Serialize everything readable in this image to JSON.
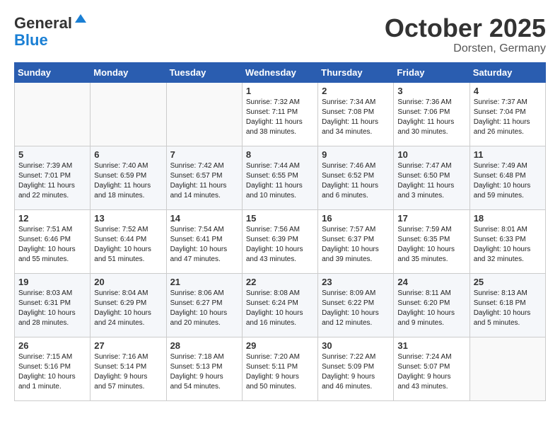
{
  "header": {
    "logo_line1": "General",
    "logo_line2": "Blue",
    "month": "October 2025",
    "location": "Dorsten, Germany"
  },
  "days_of_week": [
    "Sunday",
    "Monday",
    "Tuesday",
    "Wednesday",
    "Thursday",
    "Friday",
    "Saturday"
  ],
  "weeks": [
    [
      {
        "num": "",
        "info": ""
      },
      {
        "num": "",
        "info": ""
      },
      {
        "num": "",
        "info": ""
      },
      {
        "num": "1",
        "info": "Sunrise: 7:32 AM\nSunset: 7:11 PM\nDaylight: 11 hours\nand 38 minutes."
      },
      {
        "num": "2",
        "info": "Sunrise: 7:34 AM\nSunset: 7:08 PM\nDaylight: 11 hours\nand 34 minutes."
      },
      {
        "num": "3",
        "info": "Sunrise: 7:36 AM\nSunset: 7:06 PM\nDaylight: 11 hours\nand 30 minutes."
      },
      {
        "num": "4",
        "info": "Sunrise: 7:37 AM\nSunset: 7:04 PM\nDaylight: 11 hours\nand 26 minutes."
      }
    ],
    [
      {
        "num": "5",
        "info": "Sunrise: 7:39 AM\nSunset: 7:01 PM\nDaylight: 11 hours\nand 22 minutes."
      },
      {
        "num": "6",
        "info": "Sunrise: 7:40 AM\nSunset: 6:59 PM\nDaylight: 11 hours\nand 18 minutes."
      },
      {
        "num": "7",
        "info": "Sunrise: 7:42 AM\nSunset: 6:57 PM\nDaylight: 11 hours\nand 14 minutes."
      },
      {
        "num": "8",
        "info": "Sunrise: 7:44 AM\nSunset: 6:55 PM\nDaylight: 11 hours\nand 10 minutes."
      },
      {
        "num": "9",
        "info": "Sunrise: 7:46 AM\nSunset: 6:52 PM\nDaylight: 11 hours\nand 6 minutes."
      },
      {
        "num": "10",
        "info": "Sunrise: 7:47 AM\nSunset: 6:50 PM\nDaylight: 11 hours\nand 3 minutes."
      },
      {
        "num": "11",
        "info": "Sunrise: 7:49 AM\nSunset: 6:48 PM\nDaylight: 10 hours\nand 59 minutes."
      }
    ],
    [
      {
        "num": "12",
        "info": "Sunrise: 7:51 AM\nSunset: 6:46 PM\nDaylight: 10 hours\nand 55 minutes."
      },
      {
        "num": "13",
        "info": "Sunrise: 7:52 AM\nSunset: 6:44 PM\nDaylight: 10 hours\nand 51 minutes."
      },
      {
        "num": "14",
        "info": "Sunrise: 7:54 AM\nSunset: 6:41 PM\nDaylight: 10 hours\nand 47 minutes."
      },
      {
        "num": "15",
        "info": "Sunrise: 7:56 AM\nSunset: 6:39 PM\nDaylight: 10 hours\nand 43 minutes."
      },
      {
        "num": "16",
        "info": "Sunrise: 7:57 AM\nSunset: 6:37 PM\nDaylight: 10 hours\nand 39 minutes."
      },
      {
        "num": "17",
        "info": "Sunrise: 7:59 AM\nSunset: 6:35 PM\nDaylight: 10 hours\nand 35 minutes."
      },
      {
        "num": "18",
        "info": "Sunrise: 8:01 AM\nSunset: 6:33 PM\nDaylight: 10 hours\nand 32 minutes."
      }
    ],
    [
      {
        "num": "19",
        "info": "Sunrise: 8:03 AM\nSunset: 6:31 PM\nDaylight: 10 hours\nand 28 minutes."
      },
      {
        "num": "20",
        "info": "Sunrise: 8:04 AM\nSunset: 6:29 PM\nDaylight: 10 hours\nand 24 minutes."
      },
      {
        "num": "21",
        "info": "Sunrise: 8:06 AM\nSunset: 6:27 PM\nDaylight: 10 hours\nand 20 minutes."
      },
      {
        "num": "22",
        "info": "Sunrise: 8:08 AM\nSunset: 6:24 PM\nDaylight: 10 hours\nand 16 minutes."
      },
      {
        "num": "23",
        "info": "Sunrise: 8:09 AM\nSunset: 6:22 PM\nDaylight: 10 hours\nand 12 minutes."
      },
      {
        "num": "24",
        "info": "Sunrise: 8:11 AM\nSunset: 6:20 PM\nDaylight: 10 hours\nand 9 minutes."
      },
      {
        "num": "25",
        "info": "Sunrise: 8:13 AM\nSunset: 6:18 PM\nDaylight: 10 hours\nand 5 minutes."
      }
    ],
    [
      {
        "num": "26",
        "info": "Sunrise: 7:15 AM\nSunset: 5:16 PM\nDaylight: 10 hours\nand 1 minute."
      },
      {
        "num": "27",
        "info": "Sunrise: 7:16 AM\nSunset: 5:14 PM\nDaylight: 9 hours\nand 57 minutes."
      },
      {
        "num": "28",
        "info": "Sunrise: 7:18 AM\nSunset: 5:13 PM\nDaylight: 9 hours\nand 54 minutes."
      },
      {
        "num": "29",
        "info": "Sunrise: 7:20 AM\nSunset: 5:11 PM\nDaylight: 9 hours\nand 50 minutes."
      },
      {
        "num": "30",
        "info": "Sunrise: 7:22 AM\nSunset: 5:09 PM\nDaylight: 9 hours\nand 46 minutes."
      },
      {
        "num": "31",
        "info": "Sunrise: 7:24 AM\nSunset: 5:07 PM\nDaylight: 9 hours\nand 43 minutes."
      },
      {
        "num": "",
        "info": ""
      }
    ]
  ]
}
